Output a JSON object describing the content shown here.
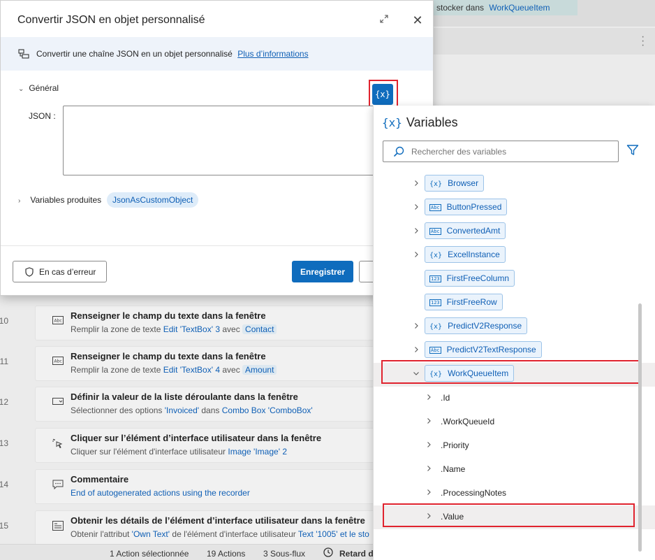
{
  "background": {
    "top_chip_text": "stocker dans",
    "top_chip_var": "WorkQueueItem",
    "steps": [
      {
        "num": "10",
        "title": "Renseigner le champ du texte dans la fenêtre",
        "desc_pre": "Remplir la zone de texte ",
        "desc_link": "Edit 'TextBox' 3",
        "desc_mid": " avec ",
        "desc_tag": "Contact",
        "icon": "textbox-icon"
      },
      {
        "num": "11",
        "title": "Renseigner le champ du texte dans la fenêtre",
        "desc_pre": "Remplir la zone de texte ",
        "desc_link": "Edit 'TextBox' 4",
        "desc_mid": " avec ",
        "desc_tag": "Amount",
        "icon": "textbox-icon"
      },
      {
        "num": "12",
        "title": "Définir la valeur de la liste déroulante dans la fenêtre",
        "desc_pre": "Sélectionner des options ",
        "desc_link": "'Invoiced'",
        "desc_mid": " dans ",
        "desc_tag": "Combo Box 'ComboBox'",
        "icon": "dropdown-icon"
      },
      {
        "num": "13",
        "title": "Cliquer sur l’élément d’interface utilisateur dans la fenêtre",
        "desc_pre": "Cliquer sur l'élément d'interface utilisateur ",
        "desc_link": "Image 'Image' 2",
        "desc_mid": "",
        "desc_tag": "",
        "icon": "click-icon"
      },
      {
        "num": "14",
        "title": "Commentaire",
        "desc_pre": "",
        "desc_link": "End of autogenerated actions using the recorder",
        "desc_mid": "",
        "desc_tag": "",
        "icon": "comment-icon"
      },
      {
        "num": "15",
        "title": "Obtenir les détails de l’élément d’interface utilisateur dans la fenêtre",
        "desc_pre": "Obtenir l'attribut ",
        "desc_link": "'Own Text'",
        "desc_mid": " de l'élément d'interface utilisateur ",
        "desc_tag": "Text '1005' et le sto",
        "icon": "details-icon"
      }
    ],
    "status": {
      "selected": "1 Action sélectionnée",
      "actions": "19 Actions",
      "subflows": "3 Sous-flux",
      "delay": "Retard d'"
    }
  },
  "dialog": {
    "title": "Convertir JSON en objet personnalisé",
    "info_text": "Convertir une chaîne JSON en un objet personnalisé",
    "info_link": "Plus d’informations",
    "section_general": "Général",
    "var_button": "{x}",
    "json_label": "JSON :",
    "json_value": "",
    "produced_label": "Variables produites",
    "produced_var": "JsonAsCustomObject",
    "on_error": "En cas d’erreur",
    "save": "Enregistrer"
  },
  "variables_pane": {
    "title": "Variables",
    "title_icon": "{x}",
    "search_placeholder": "Rechercher des variables",
    "items": [
      {
        "name": "Browser",
        "type_icon": "{x}",
        "type": "custom",
        "expandable": true
      },
      {
        "name": "ButtonPressed",
        "type_icon": "Abc",
        "type": "text",
        "expandable": true
      },
      {
        "name": "ConvertedAmt",
        "type_icon": "Abc",
        "type": "text",
        "expandable": true
      },
      {
        "name": "ExcelInstance",
        "type_icon": "{x}",
        "type": "custom",
        "expandable": true
      },
      {
        "name": "FirstFreeColumn",
        "type_icon": "123",
        "type": "number",
        "expandable": false
      },
      {
        "name": "FirstFreeRow",
        "type_icon": "123",
        "type": "number",
        "expandable": false
      },
      {
        "name": "PredictV2Response",
        "type_icon": "{x}",
        "type": "custom",
        "expandable": true
      },
      {
        "name": "PredictV2TextResponse",
        "type_icon": "Abc",
        "type": "text",
        "expandable": true
      },
      {
        "name": "WorkQueueItem",
        "type_icon": "{x}",
        "type": "custom",
        "expandable": true,
        "expanded": true
      }
    ],
    "properties": [
      ".Id",
      ".WorkQueueId",
      ".Priority",
      ".Name",
      ".ProcessingNotes",
      ".Value"
    ],
    "colors": {
      "accent": "#0f6cbd",
      "highlight": "#e0232e"
    }
  }
}
